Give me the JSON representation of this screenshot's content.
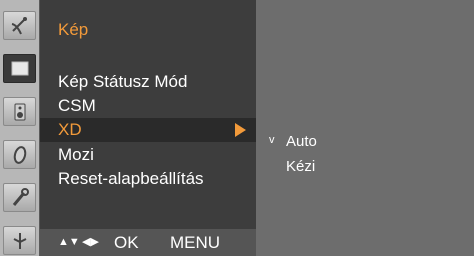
{
  "side_icons": [
    {
      "icon": "satellite-dish-icon",
      "active": false
    },
    {
      "icon": "picture-icon",
      "active": true
    },
    {
      "icon": "speaker-icon",
      "active": false
    },
    {
      "icon": "clock-icon",
      "active": false
    },
    {
      "icon": "tools-icon",
      "active": false
    },
    {
      "icon": "antenna-icon",
      "active": false
    }
  ],
  "menu": {
    "title": "Kép",
    "items": [
      {
        "label": "Kép Státusz Mód",
        "selected": false
      },
      {
        "label": "CSM",
        "selected": false
      },
      {
        "label": "XD",
        "selected": true
      },
      {
        "label": "Mozi",
        "selected": false
      },
      {
        "label": "Reset-alapbeállítás",
        "selected": false
      }
    ]
  },
  "nav": {
    "updown": "▲▼",
    "leftright": "◀▶",
    "ok": "OK",
    "menu": "MENU"
  },
  "submenu": {
    "check_mark": "v",
    "options": [
      "Auto",
      "Kézi"
    ],
    "selected_index": 0
  },
  "colors": {
    "accent": "#f29a3a",
    "panel": "#3d3d3d",
    "background": "#6d6d6d"
  }
}
